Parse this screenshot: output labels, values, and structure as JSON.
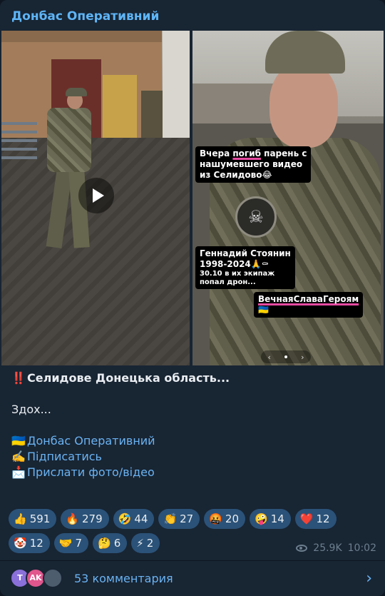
{
  "channel": {
    "name": "Донбас Оперативний"
  },
  "media": {
    "right_overlay": {
      "tag1_pre": "Вчера ",
      "tag1_hl": "погиб",
      "tag1_post": " парень с",
      "tag1_line2": "нашумевшего видео",
      "tag1_line3": "из Селидово😂",
      "tag2_line1": "Геннадий Стоянин",
      "tag2_line2": "1998-2024🙏⚰",
      "tag2_line3": "30.10 в их экипаж",
      "tag2_line4": "попал дрон...",
      "tag3_line1": "ВечнаяСлаваГероям",
      "tag3_line2": "🇺🇦"
    }
  },
  "caption": {
    "line1_icon": "‼️",
    "line1": "Селидове Донецька область...",
    "line2": "Здох...",
    "link1_icon": "🇺🇦",
    "link1": "Донбас Оперативний",
    "link2_icon": "✍️",
    "link2": "Підписатись",
    "link3_icon": "📩",
    "link3": "Прислати фото/відео"
  },
  "reactions": [
    {
      "emoji": "👍",
      "count": "591"
    },
    {
      "emoji": "🔥",
      "count": "279"
    },
    {
      "emoji": "🤣",
      "count": "44"
    },
    {
      "emoji": "👏",
      "count": "27"
    },
    {
      "emoji": "🤬",
      "count": "20"
    },
    {
      "emoji": "🤪",
      "count": "14"
    },
    {
      "emoji": "❤️",
      "count": "12"
    },
    {
      "emoji": "🤡",
      "count": "12"
    },
    {
      "emoji": "🤝",
      "count": "7"
    },
    {
      "emoji": "🤔",
      "count": "6"
    },
    {
      "emoji": "⚡",
      "count": "2"
    }
  ],
  "meta": {
    "views": "25.9K",
    "time": "10:02"
  },
  "comments": {
    "label": "53 комментария",
    "avatar1": "T",
    "avatar2": "AK"
  }
}
